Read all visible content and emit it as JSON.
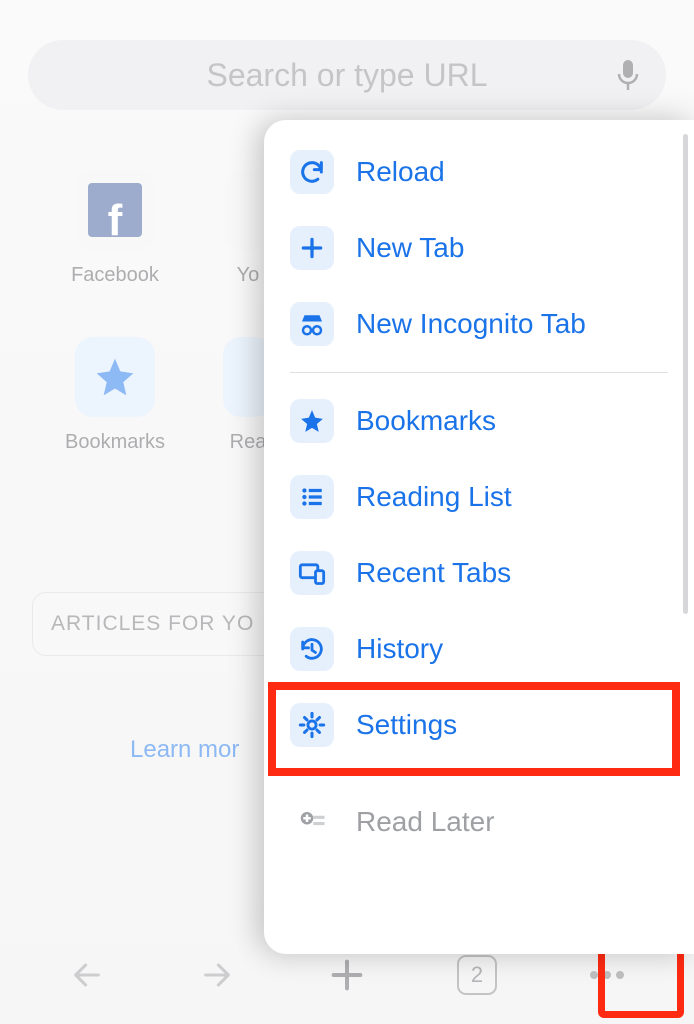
{
  "search": {
    "placeholder": "Search or type URL"
  },
  "shortcuts": [
    {
      "label": "Facebook"
    },
    {
      "label": "Yo"
    },
    {
      "label": "Bookmarks"
    },
    {
      "label": "Rea"
    }
  ],
  "articles": {
    "label": "ARTICLES FOR YO"
  },
  "learn_more": "Learn mor",
  "bottom": {
    "tab_count": "2"
  },
  "menu": {
    "items": [
      {
        "label": "Reload"
      },
      {
        "label": "New Tab"
      },
      {
        "label": "New Incognito Tab"
      },
      {
        "label": "Bookmarks"
      },
      {
        "label": "Reading List"
      },
      {
        "label": "Recent Tabs"
      },
      {
        "label": "History"
      },
      {
        "label": "Settings"
      },
      {
        "label": "Read Later"
      }
    ]
  }
}
